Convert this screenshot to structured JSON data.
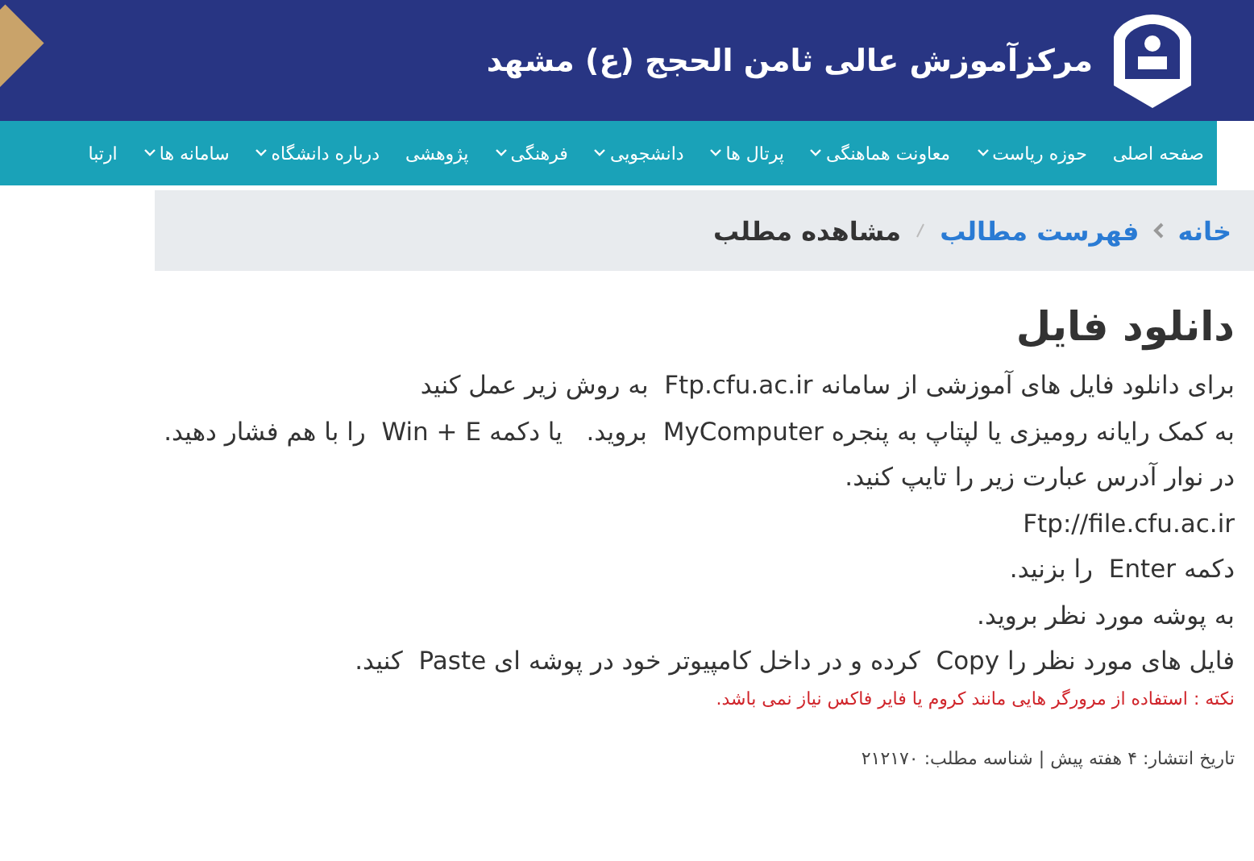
{
  "header": {
    "title": "مرکزآموزش عالی ثامن الحجج (ع) مشهد"
  },
  "nav": [
    {
      "label": "صفحه اصلی",
      "has_menu": false
    },
    {
      "label": "حوزه ریاست",
      "has_menu": true
    },
    {
      "label": "معاونت هماهنگی",
      "has_menu": true
    },
    {
      "label": "پرتال ها",
      "has_menu": true
    },
    {
      "label": "دانشجویی",
      "has_menu": true
    },
    {
      "label": "فرهنگی",
      "has_menu": true
    },
    {
      "label": "پژوهشی",
      "has_menu": false
    },
    {
      "label": "درباره دانشگاه",
      "has_menu": true
    },
    {
      "label": "سامانه ها",
      "has_menu": true
    },
    {
      "label": "ارتبا",
      "has_menu": false
    }
  ],
  "breadcrumb": [
    {
      "label": "خانه",
      "kind": "link"
    },
    {
      "label": "فهرست مطالب",
      "kind": "link"
    },
    {
      "label": "مشاهده مطلب",
      "kind": "current"
    }
  ],
  "article": {
    "title": "دانلود فایل",
    "lines": [
      "برای دانلود فایل های آموزشی از سامانه Ftp.cfu.ac.ir  به روش زیر عمل کنید",
      "به کمک رایانه رومیزی یا لپتاپ به پنجره MyComputer  بروید.   یا دکمه Win + E  را با هم فشار دهید.",
      "در نوار آدرس عبارت زیر را تایپ کنید.",
      "Ftp://file.cfu.ac.ir",
      "دکمه Enter  را بزنید.",
      "به پوشه مورد نظر بروید.",
      "فایل های مورد نظر را Copy  کرده و در داخل کامپیوتر خود در پوشه ای Paste  کنید."
    ],
    "note": "نکته : استفاده از مرورگر هایی مانند کروم یا فایر فاکس نیاز نمی باشد.",
    "meta": "تاریخ انتشار: ۴ هفته پیش | شناسه مطلب: ۲۱۲۱۷۰"
  }
}
